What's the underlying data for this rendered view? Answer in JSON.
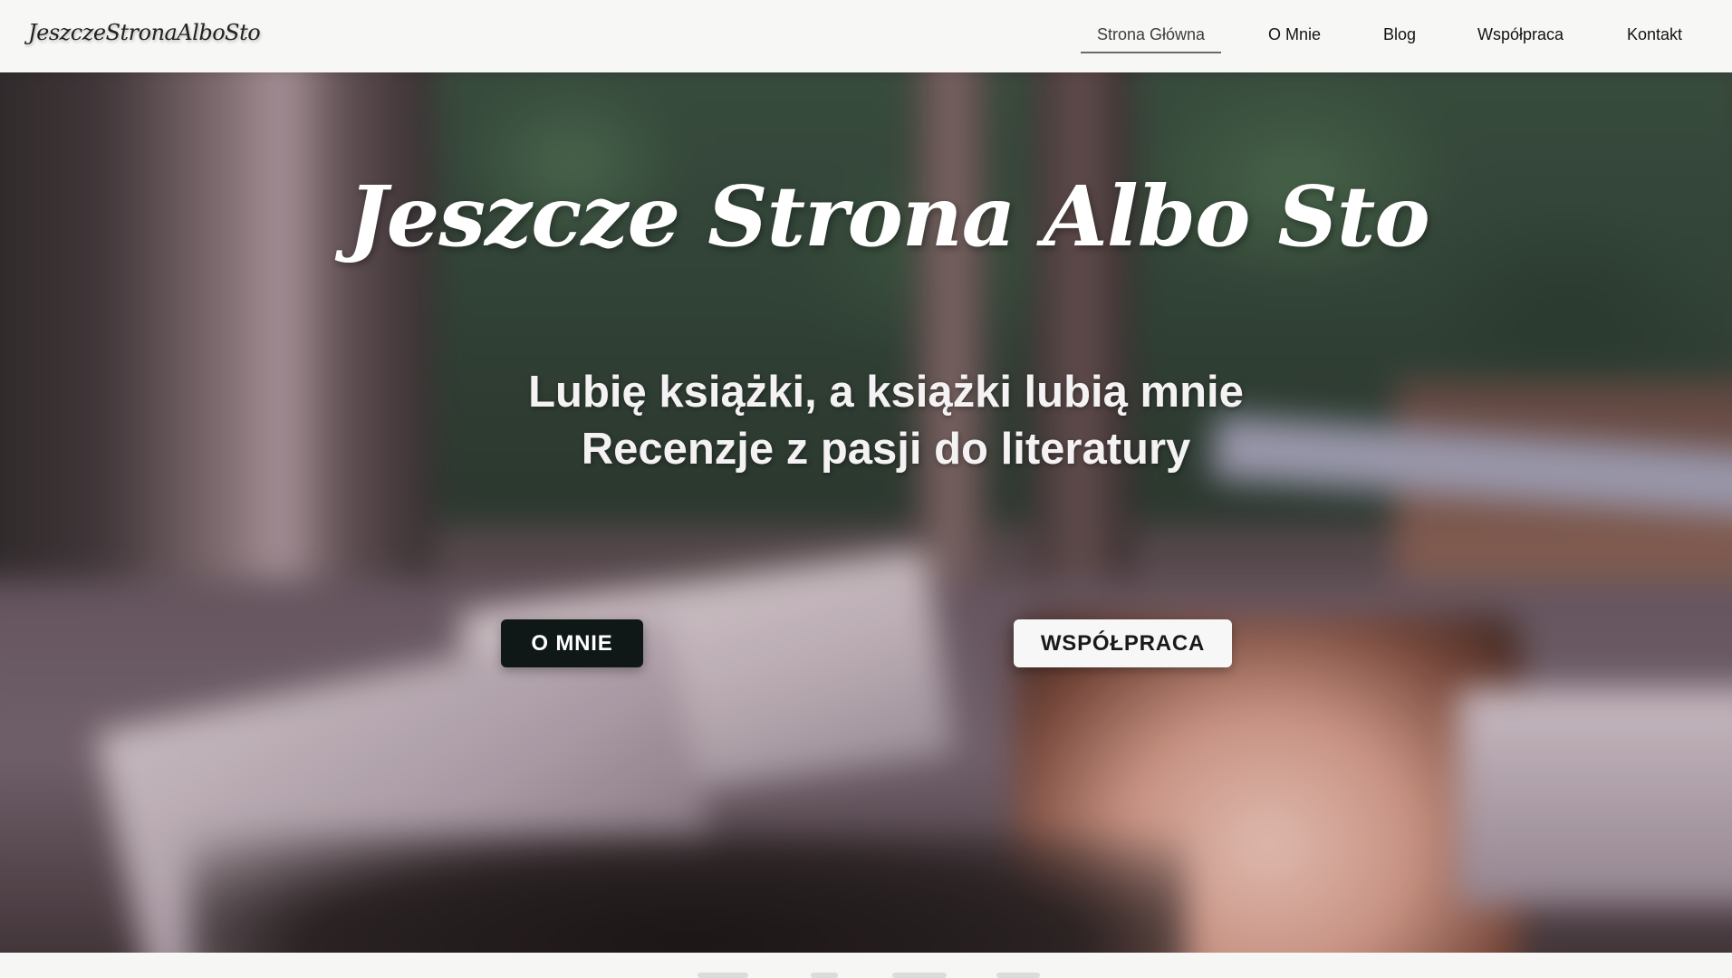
{
  "nav": {
    "logo": "JeszczeStronaAlboSto",
    "items": [
      {
        "label": "Strona Główna",
        "active": true
      },
      {
        "label": "O Mnie",
        "active": false
      },
      {
        "label": "Blog",
        "active": false
      },
      {
        "label": "Współpraca",
        "active": false
      },
      {
        "label": "Kontakt",
        "active": false
      }
    ]
  },
  "hero": {
    "title": "Jeszcze Strona Albo Sto",
    "subtitle_line1": "Lubię książki, a książki lubią mnie",
    "subtitle_line2": "Recenzje z pasji do literatury",
    "buttons": {
      "about_label": "O MNIE",
      "collab_label": "WSPÓŁPRACA"
    }
  },
  "colors": {
    "nav_background": "#f7f7f6",
    "button_dark": "#0f1717",
    "button_light": "#f7f7f7",
    "hero_text": "#ffffff"
  }
}
